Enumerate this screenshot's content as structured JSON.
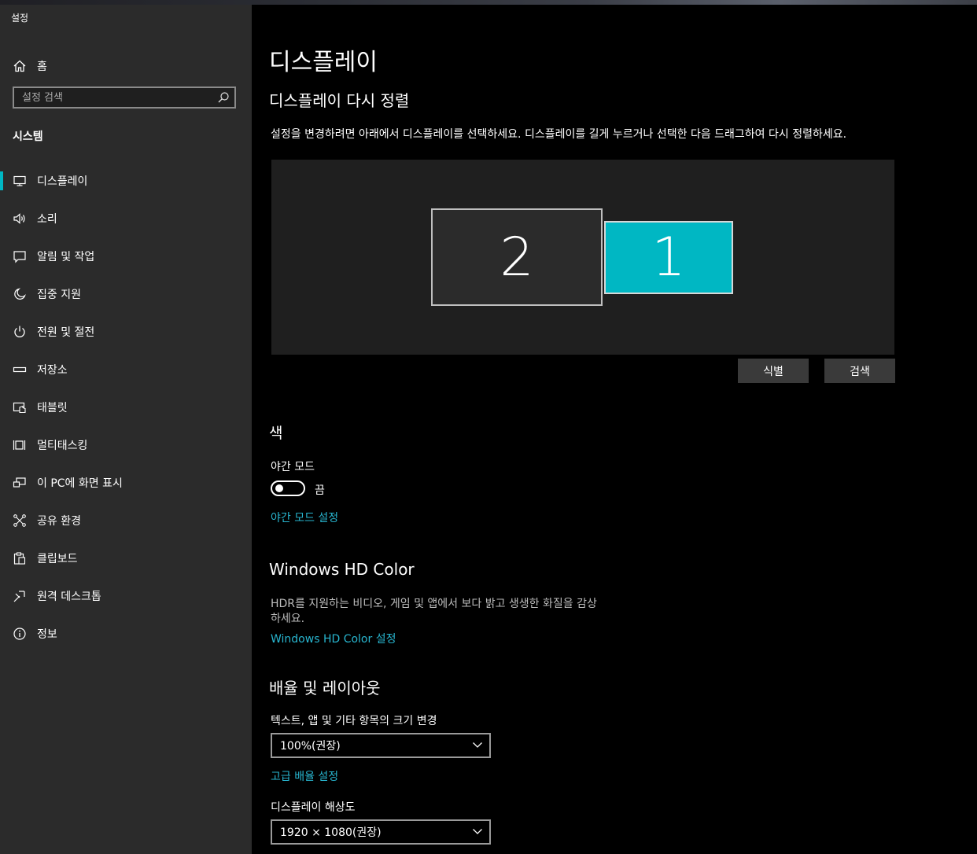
{
  "window": {
    "title": "설정"
  },
  "sidebar": {
    "home_label": "홈",
    "search_placeholder": "설정 검색",
    "section_title": "시스템",
    "items": [
      {
        "label": "디스플레이",
        "icon": "monitor-icon",
        "active": true
      },
      {
        "label": "소리",
        "icon": "speaker-icon"
      },
      {
        "label": "알림 및 작업",
        "icon": "notification-icon"
      },
      {
        "label": "집중 지원",
        "icon": "moon-icon"
      },
      {
        "label": "전원 및 절전",
        "icon": "power-icon"
      },
      {
        "label": "저장소",
        "icon": "storage-icon"
      },
      {
        "label": "태블릿",
        "icon": "tablet-icon"
      },
      {
        "label": "멀티태스킹",
        "icon": "multitasking-icon"
      },
      {
        "label": "이 PC에 화면 표시",
        "icon": "project-icon"
      },
      {
        "label": "공유 환경",
        "icon": "shared-experience-icon"
      },
      {
        "label": "클립보드",
        "icon": "clipboard-icon"
      },
      {
        "label": "원격 데스크톱",
        "icon": "remote-desktop-icon"
      },
      {
        "label": "정보",
        "icon": "info-icon"
      }
    ]
  },
  "main": {
    "title": "디스플레이",
    "rearrange": {
      "heading": "디스플레이 다시 정렬",
      "description": "설정을 변경하려면 아래에서 디스플레이를 선택하세요. 디스플레이를 길게 누르거나 선택한 다음 드래그하여 다시 정렬하세요.",
      "monitors": [
        {
          "label": "2",
          "selected": false
        },
        {
          "label": "1",
          "selected": true
        }
      ],
      "identify_label": "식별",
      "detect_label": "검색"
    },
    "color": {
      "heading": "색",
      "night_light_label": "야간 모드",
      "night_light_state": "끔",
      "night_light_link": "야간 모드 설정"
    },
    "hdr": {
      "heading": "Windows HD Color",
      "description_line1": "HDR를 지원하는 비디오, 게임 및 앱에서 보다 밝고 생생한 화질을 감상",
      "description_line2": "하세요.",
      "link": "Windows HD Color 설정"
    },
    "scale": {
      "heading": "배율 및 레이아웃",
      "scale_label": "텍스트, 앱 및 기타 항목의 크기 변경",
      "scale_value": "100%(권장)",
      "advanced_link": "고급 배율 설정",
      "resolution_label": "디스플레이 해상도",
      "resolution_value": "1920 × 1080(권장)"
    }
  },
  "colors": {
    "accent": "#00b7c3",
    "link": "#28b6d0",
    "sidebar_bg": "#2b2b2b"
  }
}
